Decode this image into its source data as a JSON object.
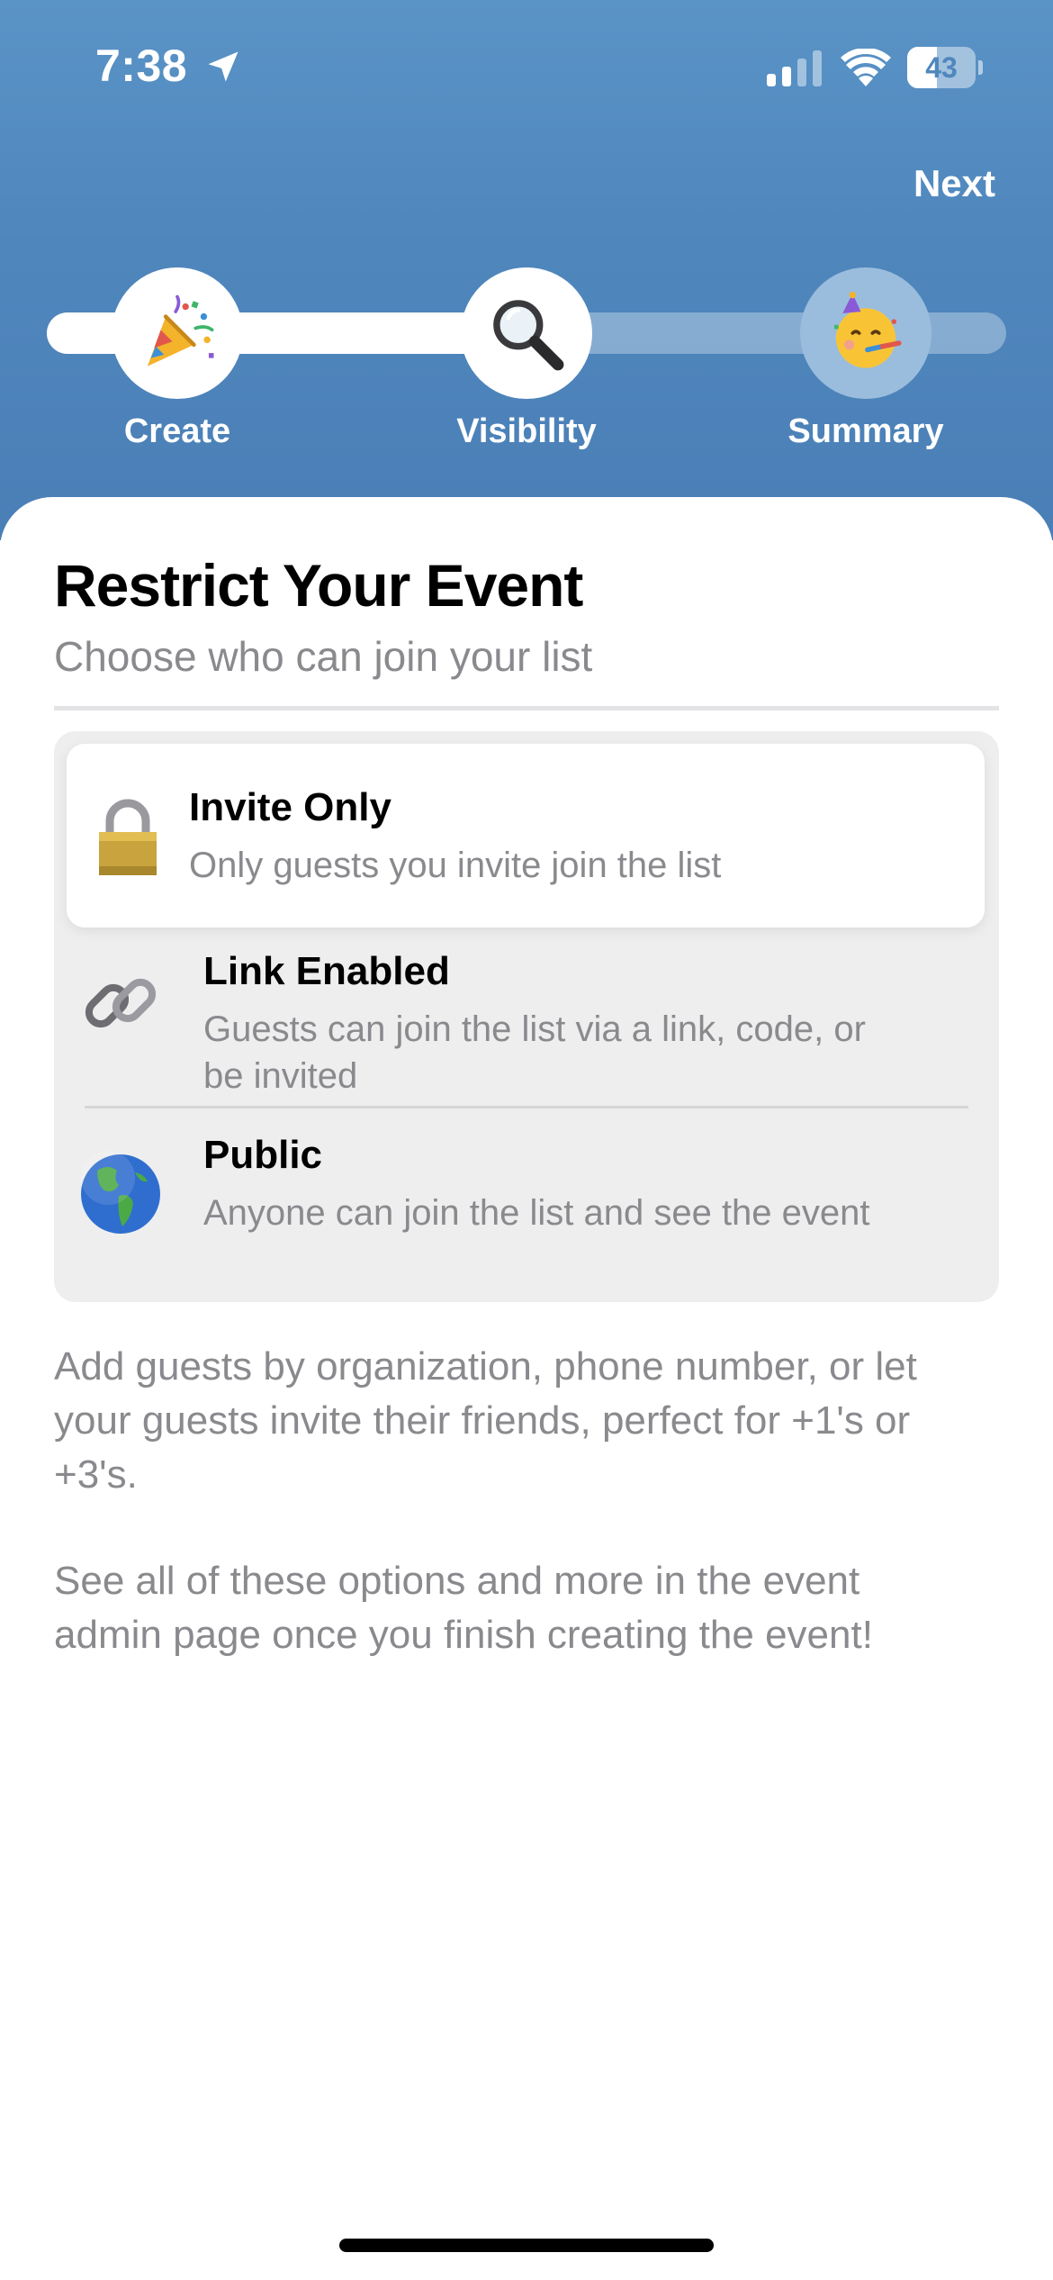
{
  "status_bar": {
    "time": "7:38",
    "battery_level": "43",
    "battery_fraction": 0.43
  },
  "header": {
    "next_label": "Next"
  },
  "stepper": {
    "progress_fraction": 0.5,
    "steps": [
      {
        "label": "Create",
        "icon": "party-popper-icon",
        "state": "done"
      },
      {
        "label": "Visibility",
        "icon": "magnifying-glass-icon",
        "state": "current"
      },
      {
        "label": "Summary",
        "icon": "partying-face-icon",
        "state": "pending"
      }
    ]
  },
  "content": {
    "title": "Restrict Your Event",
    "subtitle": "Choose who can join your list"
  },
  "options": [
    {
      "title": "Invite Only",
      "description": "Only guests you invite join the list",
      "icon": "lock-icon",
      "selected": true
    },
    {
      "title": "Link Enabled",
      "description_line1": "Guests can join the list via a link, code, or",
      "description_line2": "be invited",
      "icon": "link-icon",
      "selected": false
    },
    {
      "title": "Public",
      "description": "Anyone can join the list and see the event",
      "icon": "globe-icon",
      "selected": false
    }
  ],
  "info": {
    "paragraph1": [
      "Add guests by organization, phone number, or let",
      "your guests invite their friends, perfect for +1's or",
      "+3's."
    ],
    "paragraph2": [
      "See all of these options and more in the event",
      "admin page once you finish creating the event!"
    ]
  },
  "colors": {
    "header_top": "#5a93c6",
    "header_bottom": "#4a7fb6",
    "secondary_text": "#8a8a8e",
    "group_background": "#eeeeef"
  }
}
